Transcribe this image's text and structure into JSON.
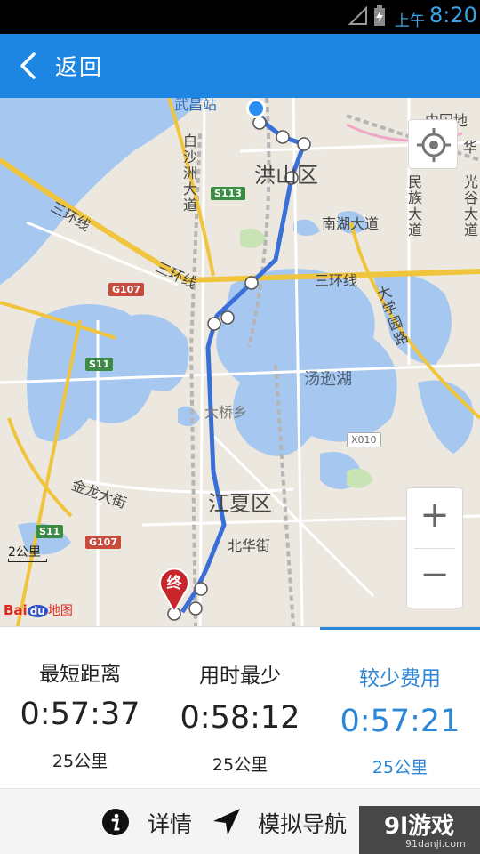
{
  "status_bar": {
    "ampm": "上午",
    "time": "8:20"
  },
  "header": {
    "back_label": "返回"
  },
  "map": {
    "districts": [
      "洪山区",
      "江夏区"
    ],
    "roads": {
      "ring_left": "三环线",
      "ring_mid": "三环线",
      "ring_right": "三环线",
      "baisha": "白沙洲大道",
      "nanhu": "南湖大道",
      "minzu": "民族大道",
      "guanggu": "光谷大道",
      "daxue": "大学园路",
      "jinlong": "金龙大街",
      "beihua": "北华街",
      "daqiao": "大桥乡",
      "wuchang_station": "武昌站"
    },
    "lake": "汤逊湖",
    "landmarks": {
      "zhongguo": "中国地",
      "hua": "华"
    },
    "shields": [
      "S113",
      "G107",
      "S11",
      "X010",
      "S11",
      "G107"
    ],
    "scale_label": "2公里",
    "logo": {
      "bai": "Bai",
      "du": "du",
      "ditu": "地图"
    },
    "end_marker": "终",
    "zoom_in": "+",
    "zoom_out": "−"
  },
  "route_options": [
    {
      "name": "最短距离",
      "time": "0:57:37",
      "distance": "25公里",
      "selected": false
    },
    {
      "name": "用时最少",
      "time": "0:58:12",
      "distance": "25公里",
      "selected": false
    },
    {
      "name": "较少费用",
      "time": "0:57:21",
      "distance": "25公里",
      "selected": true
    }
  ],
  "bottom_bar": {
    "details_label": "详情",
    "simulate_label": "模拟导航"
  },
  "watermark": {
    "main": "9l游戏",
    "sub": "91danji.com"
  },
  "colors": {
    "primary": "#1d86e3",
    "selected_text": "#2b86d8",
    "route_line": "#3b6fd8",
    "water": "#a6c8f0",
    "ring_road": "#f0c53d"
  }
}
